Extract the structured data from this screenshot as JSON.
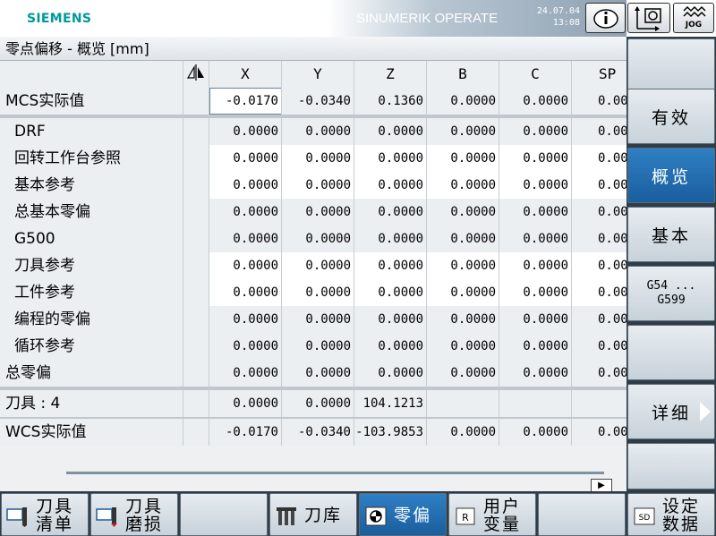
{
  "header": {
    "brand": "SIEMENS",
    "product": "SINUMERIK OPERATE",
    "date": "24.07.04",
    "time": "13:08",
    "info_icon": "info-icon",
    "mcs_icon": "coordinate-system-icon",
    "mode_label": "JOG"
  },
  "page": {
    "title": "零点偏移 - 概览 [mm]"
  },
  "table": {
    "columns": [
      "X",
      "Y",
      "Z",
      "B",
      "C",
      "SP"
    ],
    "mirror_icon": "mirror-icon",
    "rows": [
      {
        "label": "MCS实际值",
        "values": [
          "-0.0170",
          "-0.0340",
          "0.1360",
          "0.0000",
          "0.0000",
          "0.00"
        ]
      },
      {
        "label": "DRF",
        "values": [
          "0.0000",
          "0.0000",
          "0.0000",
          "0.0000",
          "0.0000",
          "0.00"
        ]
      },
      {
        "label": "回转工作台参照",
        "values": [
          "0.0000",
          "0.0000",
          "0.0000",
          "0.0000",
          "0.0000",
          "0.00"
        ]
      },
      {
        "label": "基本参考",
        "values": [
          "0.0000",
          "0.0000",
          "0.0000",
          "0.0000",
          "0.0000",
          "0.00"
        ]
      },
      {
        "label": "总基本零偏",
        "values": [
          "0.0000",
          "0.0000",
          "0.0000",
          "0.0000",
          "0.0000",
          "0.00"
        ]
      },
      {
        "label": "G500",
        "values": [
          "0.0000",
          "0.0000",
          "0.0000",
          "0.0000",
          "0.0000",
          "0.00"
        ]
      },
      {
        "label": "刀具参考",
        "values": [
          "0.0000",
          "0.0000",
          "0.0000",
          "0.0000",
          "0.0000",
          "0.00"
        ]
      },
      {
        "label": "工件参考",
        "values": [
          "0.0000",
          "0.0000",
          "0.0000",
          "0.0000",
          "0.0000",
          "0.00"
        ]
      },
      {
        "label": "编程的零偏",
        "values": [
          "0.0000",
          "0.0000",
          "0.0000",
          "0.0000",
          "0.0000",
          "0.00"
        ]
      },
      {
        "label": "循环参考",
        "values": [
          "0.0000",
          "0.0000",
          "0.0000",
          "0.0000",
          "0.0000",
          "0.00"
        ]
      },
      {
        "label": "总零偏",
        "values": [
          "0.0000",
          "0.0000",
          "0.0000",
          "0.0000",
          "0.0000",
          "0.00"
        ]
      },
      {
        "label": "刀具 : 4",
        "values": [
          "0.0000",
          "0.0000",
          "104.1213",
          "",
          "",
          ""
        ]
      },
      {
        "label": "WCS实际值",
        "values": [
          "-0.0170",
          "-0.0340",
          "-103.9853",
          "0.0000",
          "0.0000",
          "0.00"
        ]
      }
    ]
  },
  "vertical_softkeys": [
    {
      "label": ""
    },
    {
      "label": "有效"
    },
    {
      "label": "概览"
    },
    {
      "label": "基本"
    },
    {
      "label": "G54 ...",
      "label2": "G599"
    },
    {
      "label": ""
    },
    {
      "label": "详细"
    },
    {
      "label": ""
    }
  ],
  "horizontal_softkeys": [
    {
      "label": "刀具",
      "label2": "清单",
      "icon": "tool-list-icon"
    },
    {
      "label": "刀具",
      "label2": "磨损",
      "icon": "tool-wear-icon"
    },
    {
      "label": ""
    },
    {
      "label": "刀库",
      "icon": "magazine-icon"
    },
    {
      "label": "零偏",
      "icon": "work-offset-icon"
    },
    {
      "label": "用户",
      "label2": "变量",
      "icon": "r-variable-icon"
    },
    {
      "label": ""
    },
    {
      "label": "设定",
      "label2": "数据",
      "icon": "sd-icon"
    }
  ],
  "scroll": {
    "right_symbol": "▶"
  },
  "colors": {
    "accent": "#1a5e9e",
    "brand": "#009999",
    "panel": "#2f3d49"
  }
}
